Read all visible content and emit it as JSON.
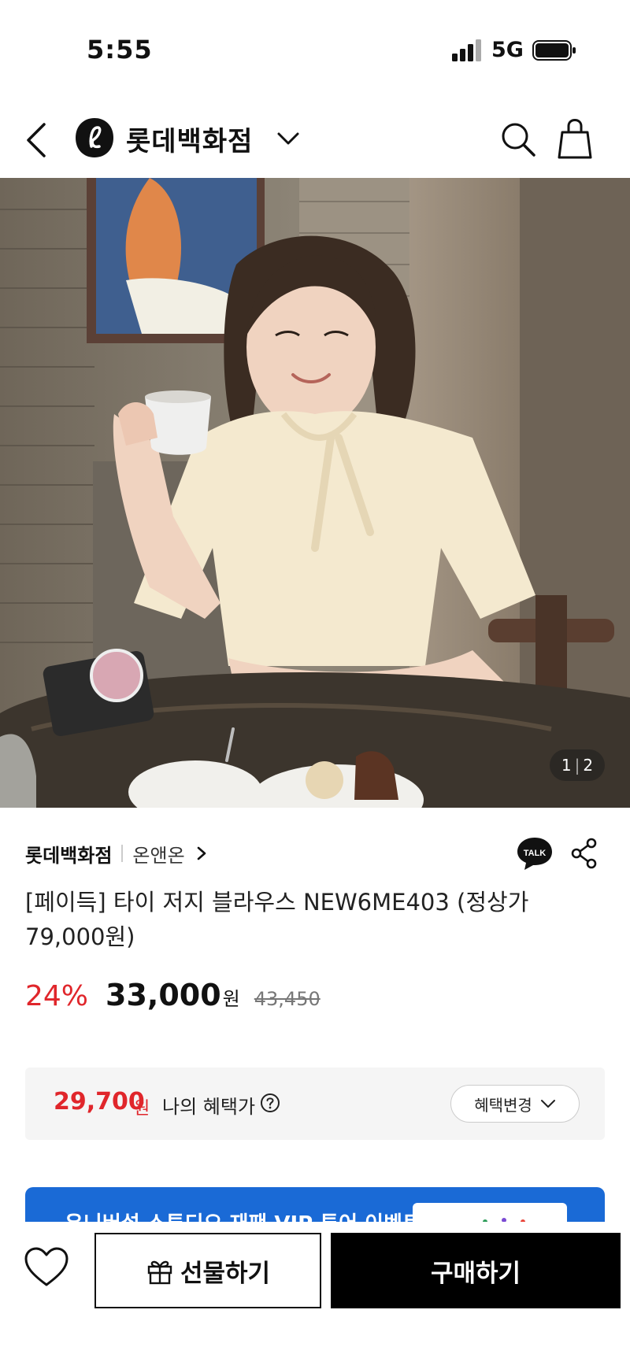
{
  "status_bar": {
    "time": "5:55",
    "network": "5G"
  },
  "header": {
    "brand_name": "롯데백화점"
  },
  "product": {
    "image_pager": {
      "current": "1",
      "total": "2"
    },
    "store": "롯데백화점",
    "brand": "온앤온",
    "title": "[페이득] 타이 저지 블라우스 NEW6ME403 (정상가 79,000원)",
    "discount": "24%",
    "price": "33,000",
    "currency": "원",
    "original_price": "43,450"
  },
  "benefit": {
    "price": "29,700",
    "currency": "원",
    "label": "나의 혜택가",
    "change_label": "혜택변경"
  },
  "event_banner": {
    "text": "유니버설 스튜디오 재팬 VIP 투어 이벤트"
  },
  "bottom_bar": {
    "gift_label": "선물하기",
    "buy_label": "구매하기"
  },
  "icons": {
    "back": "back-icon",
    "brand_logo": "lotte-logo-icon",
    "chevron": "chevron-down-icon",
    "search": "search-icon",
    "bag": "shopping-bag-icon",
    "talk": "kakao-talk-icon",
    "share": "share-icon",
    "help": "help-circle-icon",
    "wish": "heart-icon",
    "gift": "gift-icon"
  },
  "colors": {
    "discount_red": "#e0262b",
    "buy_button": "#000000",
    "banner_blue": "#1a6ad6"
  }
}
